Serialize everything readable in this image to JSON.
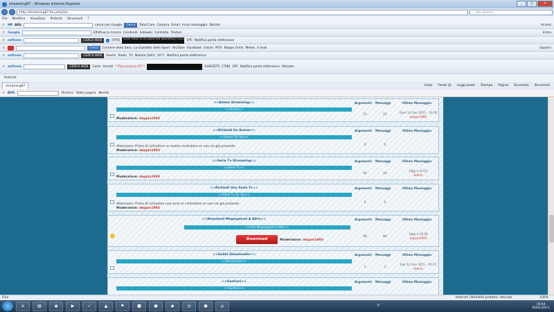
{
  "window": {
    "title": "streaming87 - Windows Internet Explorer",
    "min": "_",
    "max": "□",
    "close": "✕"
  },
  "address": {
    "url": "http://streaming87.forumfy.biz/",
    "search_placeholder": "Ask Search"
  },
  "menu": [
    "File",
    "Modifica",
    "Visualizza",
    "Preferiti",
    "Strumenti",
    "?"
  ],
  "toolbars": {
    "hp": {
      "brand": "HP",
      "aol": "AOL",
      "search_hint": "cerca con Google",
      "search_btn": "Cerca",
      "items": [
        "Total Care",
        "Compra",
        "Email",
        "Invia messaggio",
        "Notizie"
      ],
      "right": "Accedi"
    },
    "google": {
      "brand": "Google",
      "items": [
        "Effettua la ricerca",
        "Condividi",
        "Sidewiki",
        "Controllo",
        "Traduci"
      ],
      "right": "Entra"
    },
    "softonic1": {
      "brand": "softonic",
      "search_btn": "CERCA WEB",
      "radio": "[976]",
      "black": "DOVE PRESE DI UN ANDROIDE INGENERALI CLICCA TV CALL ET NACE",
      "items": [
        "1PC",
        "Notifica posta elettronica"
      ]
    },
    "ask": {
      "search_btn": "Cerca",
      "items": [
        "Corriere della Sera",
        "La Gazzetta dello Sport",
        "YouTube",
        "Facebook",
        "Giochi",
        "MTV",
        "Beppe Grillo",
        "Meteo",
        "E-mail"
      ],
      "right": "Opzioni"
    },
    "softonic2": {
      "brand": "softonic",
      "search_btn": "CERCA WEB",
      "items": [
        "Giochi",
        "Radio",
        "TV",
        "Notizie [443]",
        "20°C",
        "Notifica posta elettronica"
      ]
    },
    "softonic3": {
      "brand": "softonic",
      "search_btn": "CERCA WEB",
      "items": [
        "Carta",
        "Accedi",
        "**Riparazione PC**",
        "GADGETS",
        "[768]",
        "1PC",
        "Notifica posta elettronica",
        "Attivato"
      ]
    }
  },
  "favbar": {
    "label": "Preferiti"
  },
  "tab": {
    "label": "streaming87",
    "commands": [
      "Inizio",
      "Feeds (J)",
      "Leggi posta",
      "Stampa",
      "Pagina",
      "Sicurezza",
      "Strumenti"
    ]
  },
  "avgbar": {
    "brand": "AVG",
    "items": [
      "Ricerca",
      "Stato pagina",
      "Novità"
    ]
  },
  "forum": {
    "col_topics": "Argomenti",
    "col_posts": "Messaggi",
    "col_last": "Ultimo Messaggio",
    "moderator_label": "Moderatore:",
    "moderator": "deppio1993",
    "rows": [
      {
        "title": ">>Anime Streaming<<",
        "bar": "<<Anime>>",
        "note": "",
        "topics": "22",
        "posts": "22",
        "last_date": "Dom 16 Gen 2011 - 16:06",
        "last_user": "deppio1993"
      },
      {
        "title": ">>Richiedi Un Anime<<",
        "bar": "<<Anime For You>>",
        "note": "Attenzione: Prima di richiedere un anime controllare se non sia già presente.",
        "topics": "0",
        "posts": "0",
        "last_date": "",
        "last_user": ""
      },
      {
        "title": ">>Serie Tv Streaming<<",
        "bar": "<<Serie Tv>>",
        "note": "",
        "topics": "24",
        "posts": "24",
        "last_date": "Oggi a 12:03",
        "last_user": "Admin"
      },
      {
        "title": ">>Richiedi Una Serie Tv<<",
        "bar": "<<Serie Tv For You>>",
        "note": "Attenzione: Prima di richiedere una serie tv controllare se non sia già presente.",
        "topics": "0",
        "posts": "0",
        "last_date": "",
        "last_user": ""
      },
      {
        "title": ">>Download Megaupload & Altro<<",
        "bar": "<<Film Megaupload & Altro>>",
        "note": "",
        "topics": "84",
        "posts": "84",
        "last_date": "Oggi a 18:48",
        "last_user": "deppio1993",
        "download": "Download"
      },
      {
        "title": ">>Guida Sbamloader<<",
        "bar": "<<Sbamloader>>",
        "note": "",
        "topics": "1",
        "posts": "1",
        "last_date": "Sab 22 Gen 2011 - 16:21",
        "last_user": "Admin"
      },
      {
        "title": ">>Gestioni<<",
        "bar": "<<Gestioni>>",
        "note": "",
        "topics": "",
        "posts": "",
        "last_date": "",
        "last_user": ""
      }
    ]
  },
  "status": {
    "left": "Fine",
    "zone": "Internet | Modalità protetta: attivata",
    "zoom": "100%"
  },
  "taskbar": {
    "lang": "IT",
    "time": "19:04",
    "date": "30/01/2011"
  }
}
